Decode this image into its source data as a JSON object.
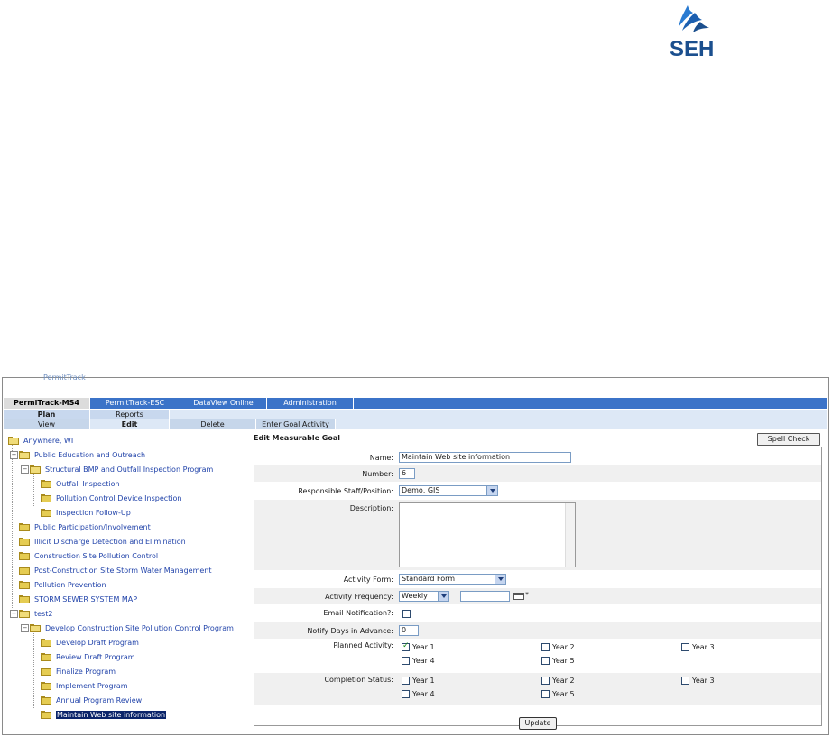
{
  "logo": {
    "text": "SEH"
  },
  "app": {
    "label": "PermitTrack",
    "top_tabs": [
      "PermiTrack-MS4",
      "PermitTrack-ESC",
      "DataView Online",
      "Administration"
    ],
    "sub_tabs": [
      "Plan",
      "Reports"
    ],
    "action_tabs": [
      "View",
      "Edit",
      "Delete",
      "Enter Goal Activity"
    ]
  },
  "tree": {
    "items": [
      "Anywhere, WI",
      "Public Education and Outreach",
      "Structural BMP and Outfall Inspection Program",
      "Outfall Inspection",
      "Pollution Control Device Inspection",
      "Inspection Follow-Up",
      "Public Participation/Involvement",
      "Illicit Discharge Detection and Elimination",
      "Construction Site Pollution Control",
      "Post-Construction Site Storm Water Management",
      "Pollution Prevention",
      "STORM SEWER SYSTEM MAP",
      "test2",
      "Develop Construction Site Pollution Control Program",
      "Develop Draft Program",
      "Review Draft Program",
      "Finalize Program",
      "Implement Program",
      "Annual Program Review",
      "Maintain Web site information"
    ]
  },
  "form": {
    "header": "Edit Measurable Goal",
    "spell_check": "Spell Check",
    "name_label": "Name:",
    "name_value": "Maintain Web site information",
    "number_label": "Number:",
    "number_value": "6",
    "staff_label": "Responsible Staff/Position:",
    "staff_value": "Demo, GIS",
    "description_label": "Description:",
    "activity_form_label": "Activity Form:",
    "activity_form_value": "Standard Form",
    "frequency_label": "Activity Frequency:",
    "frequency_value": "Weekly",
    "frequency_asterisk": "*",
    "email_label": "Email Notification?:",
    "notify_label": "Notify Days in Advance:",
    "notify_value": "0",
    "planned_label": "Planned Activity:",
    "completion_label": "Completion Status:",
    "years": [
      "Year 1",
      "Year 2",
      "Year 3",
      "Year 4",
      "Year 5"
    ],
    "planned_checked": [
      true,
      false,
      false,
      false,
      false
    ],
    "completion_checked": [
      false,
      false,
      false,
      false,
      false
    ],
    "update": "Update"
  }
}
